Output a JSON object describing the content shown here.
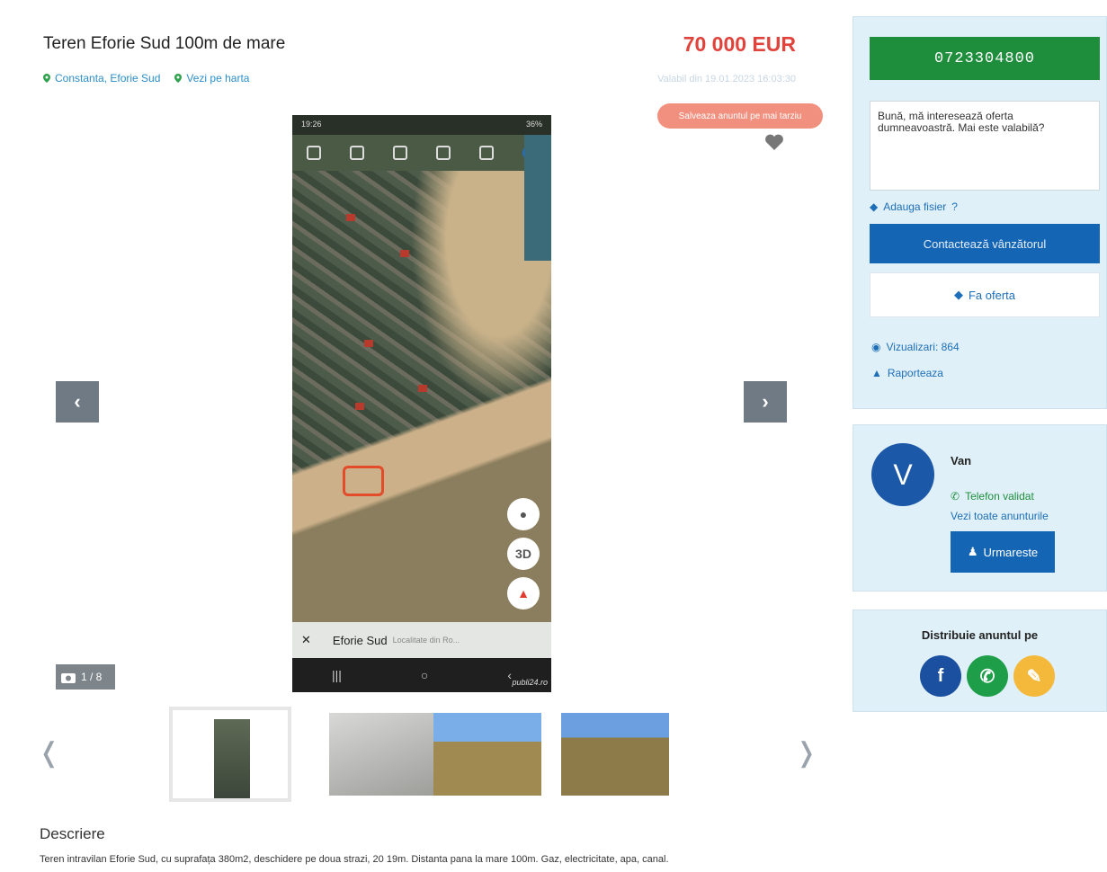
{
  "listing": {
    "title": "Teren Eforie Sud 100m de mare",
    "price": "70 000 EUR",
    "location": "Constanta, Eforie Sud",
    "map_link": "Vezi pe harta",
    "valid_since": "Valabil din 19.01.2023 16:03:30",
    "save_label": "Salveaza anuntul pe mai tarziu",
    "photo_counter": "1 / 8",
    "description_heading": "Descriere",
    "description_text": "Teren intravilan Eforie Sud, cu suprafața 380m2, deschidere pe doua strazi, 20 19m. Distanta pana la mare 100m. Gaz, electricitate, apa, canal."
  },
  "photo": {
    "status_time": "19:26",
    "status_battery": "36%",
    "place_name": "Eforie Sud",
    "place_subtitle": "Localitate din Ro...",
    "btn_3d": "3D",
    "watermark": "publi24.ro"
  },
  "contact": {
    "phone": "0723304800",
    "message": "Bună, mă interesează oferta dumneavoastră. Mai este valabilă?",
    "attach_label": "Adauga fisier",
    "attach_help": "?",
    "contact_label": "Contactează vânzătorul",
    "offer_label": "Fa oferta",
    "views": "Vizualizari: 864",
    "report": "Raporteaza"
  },
  "seller": {
    "initial": "V",
    "name": "Van",
    "phone_validated": "Telefon validat",
    "all_ads": "Vezi toate anunturile",
    "follow_label": "Urmareste"
  },
  "share": {
    "title": "Distribuie anuntul pe"
  },
  "colors": {
    "price": "#e0433c",
    "phone_button": "#1f8e3c",
    "primary_button": "#1565b5",
    "sidebar_bg": "#dff0f8"
  }
}
